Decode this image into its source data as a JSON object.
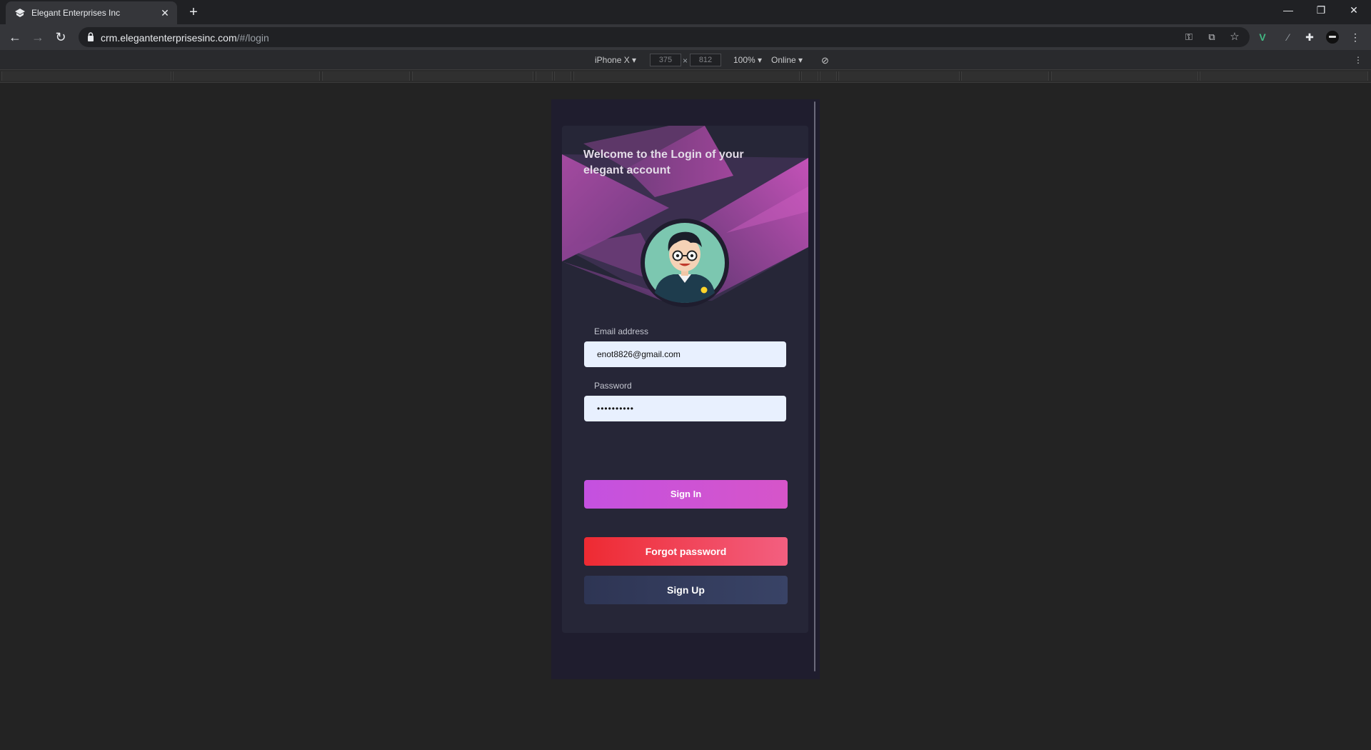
{
  "browser": {
    "tab_title": "Elegant Enterprises Inc",
    "url_host": "crm.elegantenterprisesinc.com",
    "url_path": "/#/login"
  },
  "devtools": {
    "device": "iPhone X",
    "width": "375",
    "height": "812",
    "zoom": "100%",
    "network": "Online"
  },
  "login": {
    "welcome": "Welcome to the Login of your elegant account",
    "email_label": "Email address",
    "email_value": "enot8826@gmail.com",
    "password_label": "Password",
    "password_value": "••••••••••",
    "signin_label": "Sign In",
    "forgot_label": "Forgot password",
    "signup_label": "Sign Up"
  },
  "colors": {
    "accent_magenta": "#c451e0",
    "danger_red": "#ee2a32",
    "navy": "#2e3554",
    "avatar_bg": "#7cc7b0"
  }
}
